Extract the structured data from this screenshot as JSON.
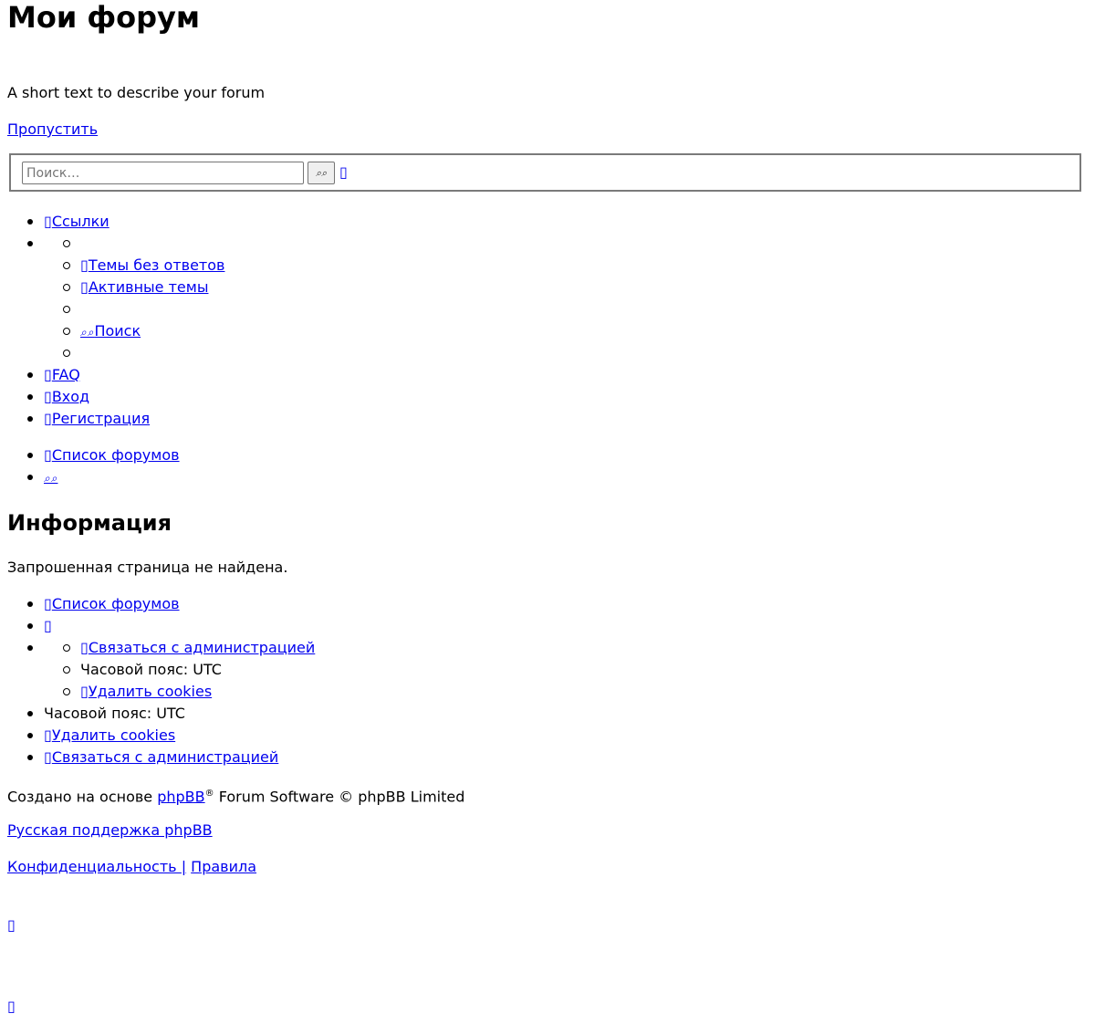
{
  "header": {
    "site_title": "Мои форум",
    "site_description": "A short text to describe your forum",
    "skip_link": "Пропустить"
  },
  "search": {
    "placeholder": "Поиск…",
    "button_glyph": "⌕⌕",
    "advanced_glyph": "▯"
  },
  "nav_main": {
    "quick_links": "Ссылки",
    "quick_links_items": {
      "unanswered": "Темы без ответов",
      "active": "Активные темы",
      "search": "Поиск"
    },
    "faq": "FAQ",
    "login": "Вход",
    "register": "Регистрация"
  },
  "breadcrumbs_top": {
    "index": "Список форумов"
  },
  "content": {
    "heading": "Информация",
    "message": "Запрошенная страница не найдена."
  },
  "nav_footer": {
    "index": "Список форумов",
    "contact": "Связаться с администрацией",
    "timezone": "Часовой пояс: UTC",
    "delete_cookies": "Удалить cookies"
  },
  "footer": {
    "powered_prefix": "Создано на основе ",
    "phpbb_link": "phpBB",
    "reg_mark": "®",
    "powered_suffix": " Forum Software © phpBB Limited",
    "russian_support": "Русская поддержка phpBB",
    "privacy": "Конфиденциальность ",
    "separator": "|",
    "terms": "Правила"
  },
  "icons": {
    "generic": "▯"
  }
}
